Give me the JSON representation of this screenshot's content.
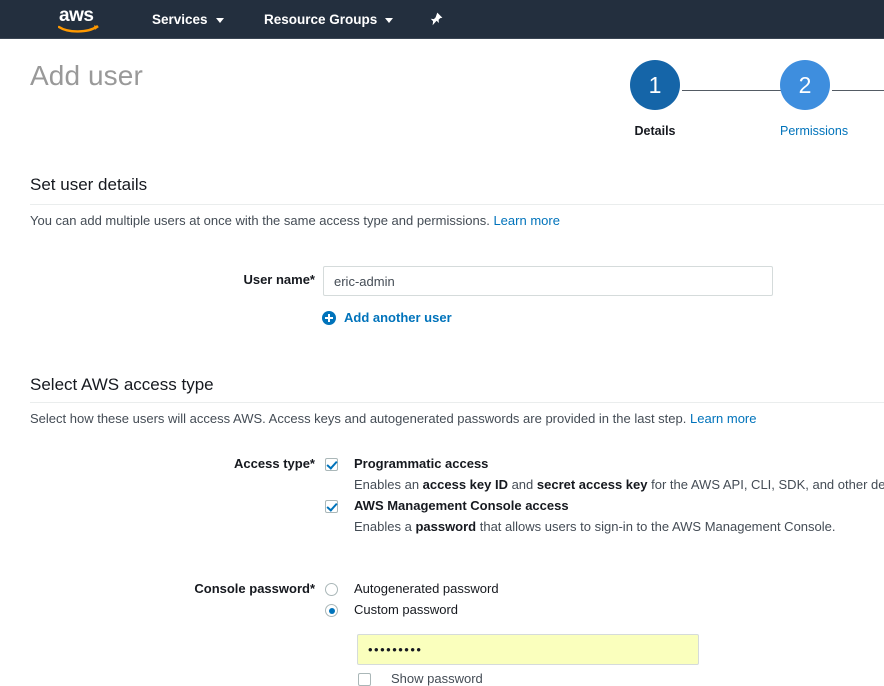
{
  "nav": {
    "logo_alt": "aws-logo",
    "items": [
      {
        "label": "Services",
        "icon": "chevron-down-icon"
      },
      {
        "label": "Resource Groups",
        "icon": "chevron-down-icon"
      }
    ],
    "pin_icon": "pin-icon",
    "background_color": "#232f3e"
  },
  "page": {
    "title": "Add user"
  },
  "wizard": {
    "steps": [
      {
        "number": "1",
        "label": "Details",
        "state": "active",
        "circle_color": "#1565a8",
        "label_color": "#16191f"
      },
      {
        "number": "2",
        "label": "Permissions",
        "state": "upcoming",
        "circle_color": "#3e8ede",
        "label_color": "#0073bb"
      }
    ]
  },
  "sections": {
    "user_details": {
      "title": "Set user details",
      "description": "You can add multiple users at once with the same access type and permissions.",
      "learn_more": "Learn more",
      "username_label": "User name*",
      "username_value": "eric-admin",
      "username_placeholder": "",
      "add_another_user": "Add another user"
    },
    "access_type": {
      "title": "Select AWS access type",
      "description": "Select how these users will access AWS. Access keys and autogenerated passwords are provided in the last step.",
      "learn_more": "Learn more",
      "access_type_label": "Access type*",
      "options": [
        {
          "label": "Programmatic access",
          "checked": true,
          "desc_1": "Enables an ",
          "desc_b1": "access key ID",
          "desc_2": " and ",
          "desc_b2": "secret access key",
          "desc_3": " for the AWS API, CLI, SDK, and other development tools."
        },
        {
          "label": "AWS Management Console access",
          "checked": true,
          "desc_1": "Enables a ",
          "desc_b1": "password",
          "desc_2": " that allows users to sign-in to the AWS Management Console.",
          "desc_b2": "",
          "desc_3": ""
        }
      ],
      "console_password_label": "Console password*",
      "password_options": [
        {
          "label": "Autogenerated password",
          "selected": false
        },
        {
          "label": "Custom password",
          "selected": true
        }
      ],
      "password_value": "•••••••••",
      "show_password_label": "Show password",
      "show_password_checked": false
    }
  },
  "colors": {
    "link": "#0073bb",
    "accent_blue": "#0073bb",
    "nav_dark": "#232f3e",
    "logo_orange": "#ff9900",
    "password_field_bg": "#faffbd"
  }
}
